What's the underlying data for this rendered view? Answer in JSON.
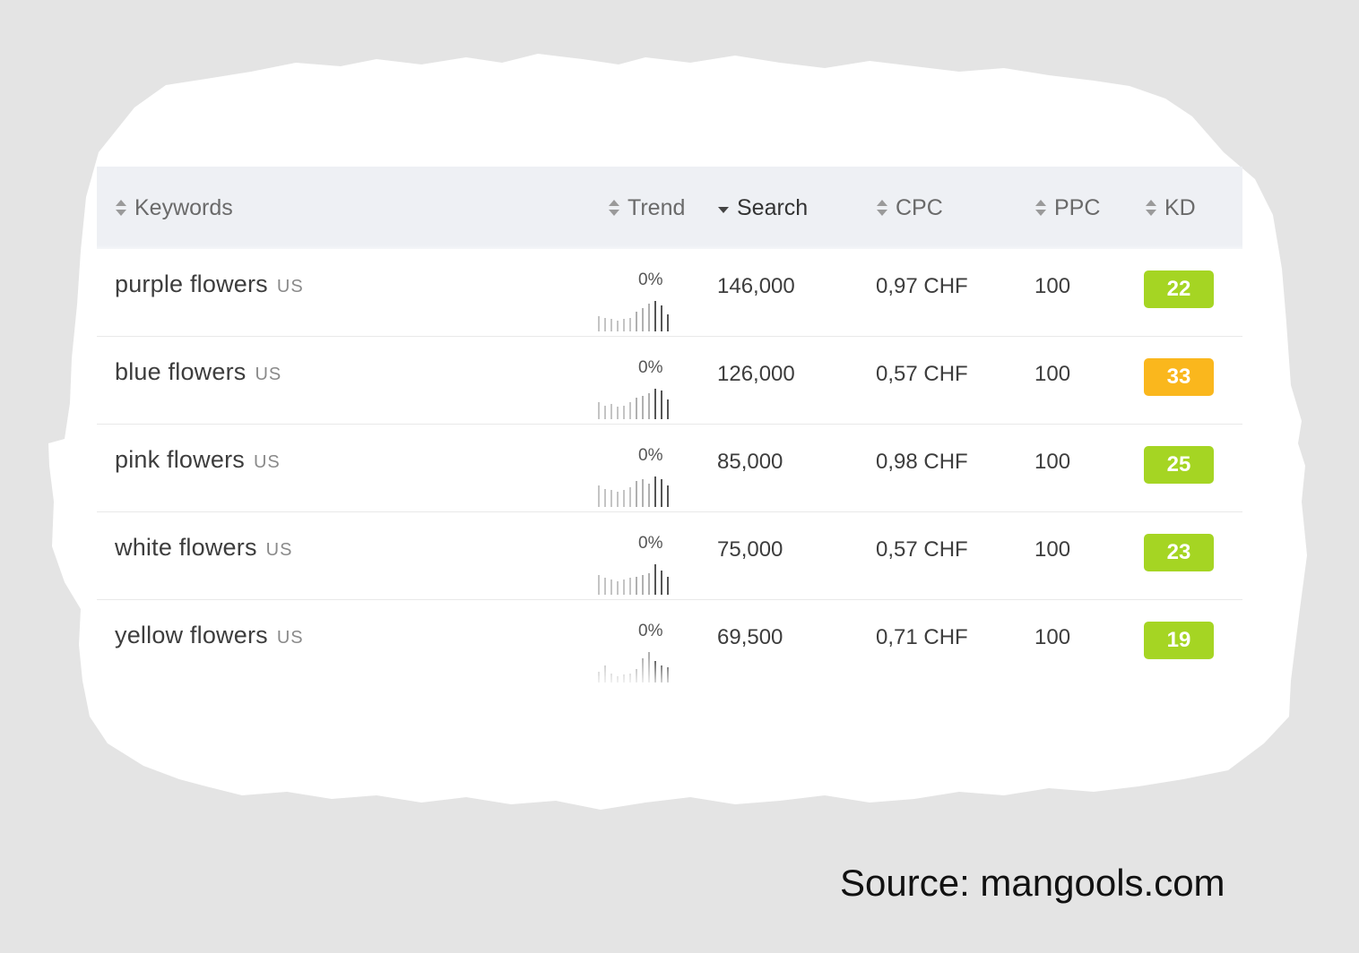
{
  "table": {
    "columns": [
      {
        "key": "keywords",
        "label": "Keywords",
        "sort_icon": "sort-both-icon",
        "active": false
      },
      {
        "key": "trend",
        "label": "Trend",
        "sort_icon": "sort-both-icon",
        "active": false
      },
      {
        "key": "search",
        "label": "Search",
        "sort_icon": "sort-desc-icon",
        "active": true
      },
      {
        "key": "cpc",
        "label": "CPC",
        "sort_icon": "sort-both-icon",
        "active": false
      },
      {
        "key": "ppc",
        "label": "PPC",
        "sort_icon": "sort-both-icon",
        "active": false
      },
      {
        "key": "kd",
        "label": "KD",
        "sort_icon": "sort-both-icon",
        "active": false
      }
    ],
    "rows": [
      {
        "keyword": "purple flowers",
        "location": "US",
        "trend_pct": "0%",
        "trend_bars": [
          0.5,
          0.45,
          0.4,
          0.35,
          0.4,
          0.45,
          0.65,
          0.75,
          0.9,
          1.0,
          0.85,
          0.55
        ],
        "search": "146,000",
        "cpc": "0,97 CHF",
        "ppc": "100",
        "kd": "22",
        "kd_color": "#a5d523"
      },
      {
        "keyword": "blue flowers",
        "location": "US",
        "trend_pct": "0%",
        "trend_bars": [
          0.55,
          0.45,
          0.5,
          0.4,
          0.45,
          0.55,
          0.7,
          0.75,
          0.85,
          1.0,
          0.95,
          0.65
        ],
        "search": "126,000",
        "cpc": "0,57 CHF",
        "ppc": "100",
        "kd": "33",
        "kd_color": "#fab71d"
      },
      {
        "keyword": "pink flowers",
        "location": "US",
        "trend_pct": "0%",
        "trend_bars": [
          0.7,
          0.6,
          0.55,
          0.5,
          0.55,
          0.65,
          0.85,
          0.9,
          0.75,
          1.0,
          0.9,
          0.7
        ],
        "search": "85,000",
        "cpc": "0,98 CHF",
        "ppc": "100",
        "kd": "25",
        "kd_color": "#a5d523"
      },
      {
        "keyword": "white flowers",
        "location": "US",
        "trend_pct": "0%",
        "trend_bars": [
          0.65,
          0.55,
          0.5,
          0.45,
          0.5,
          0.55,
          0.6,
          0.65,
          0.7,
          1.0,
          0.8,
          0.6
        ],
        "search": "75,000",
        "cpc": "0,57 CHF",
        "ppc": "100",
        "kd": "23",
        "kd_color": "#a5d523"
      },
      {
        "keyword": "yellow flowers",
        "location": "US",
        "trend_pct": "0%",
        "trend_bars": [
          0.35,
          0.55,
          0.3,
          0.2,
          0.25,
          0.3,
          0.45,
          0.8,
          1.0,
          0.7,
          0.55,
          0.5
        ],
        "search": "69,500",
        "cpc": "0,71 CHF",
        "ppc": "100",
        "kd": "19",
        "kd_color": "#a5d523"
      }
    ]
  },
  "caption": "Source: mangools.com"
}
